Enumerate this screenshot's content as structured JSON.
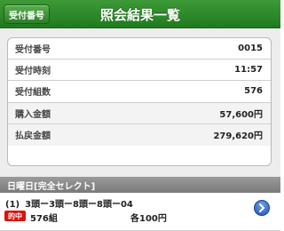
{
  "header": {
    "back_label": "受付番号",
    "title": "照会結果一覧"
  },
  "summary": [
    {
      "label": "受付番号",
      "value": "0015"
    },
    {
      "label": "受付時刻",
      "value": "11:57"
    },
    {
      "label": "受付組数",
      "value": "576"
    },
    {
      "label": "購入金額",
      "value": "57,600円"
    },
    {
      "label": "払戻金額",
      "value": "279,620円"
    }
  ],
  "section": {
    "title": "日曜日[完全セレクト]"
  },
  "bets": [
    {
      "number": "(1)",
      "combination": "3頭ー3頭ー8頭ー8頭ー04",
      "badge": "的中",
      "count": "576組",
      "unit_price": "各100円"
    }
  ],
  "colors": {
    "header_green": "#2a8a25",
    "hit_red": "#d9140d",
    "detail_blue": "#2256b8"
  },
  "icons": {
    "detail": "chevron-right-icon"
  }
}
